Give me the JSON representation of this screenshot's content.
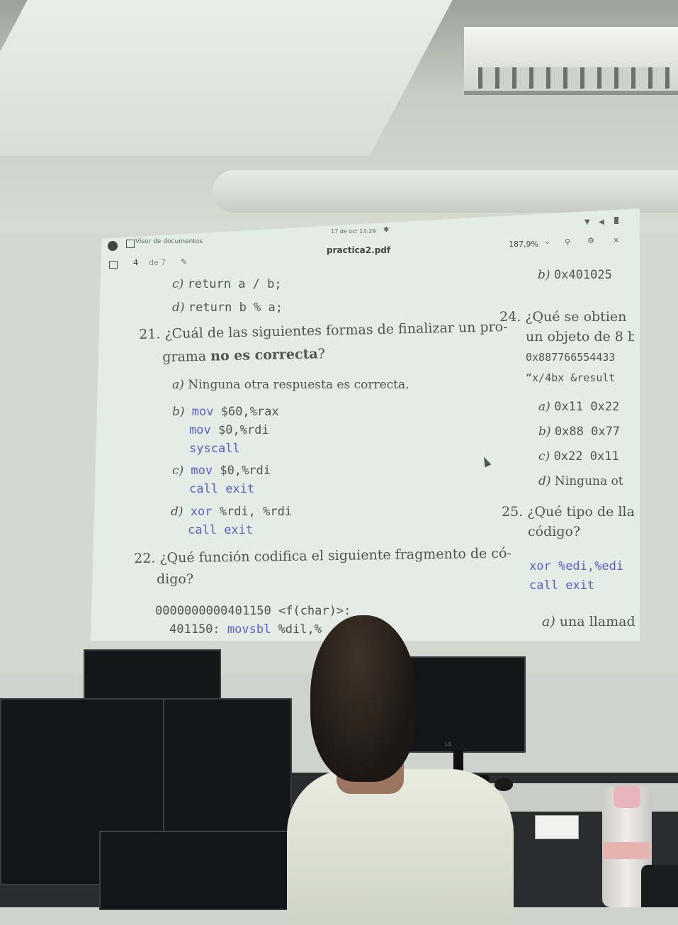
{
  "viewer": {
    "app_name": "Visor de documentos",
    "clock": "17 de oct  13:29",
    "filename": "practica2.pdf",
    "zoom": "187,9%",
    "page_current": "4",
    "page_total": "de 7"
  },
  "left_column": {
    "prev_options": [
      {
        "letter": "c)",
        "code": "return a / b;"
      },
      {
        "letter": "d)",
        "code": "return b % a;"
      }
    ],
    "q21": {
      "number": "21.",
      "text_line1": "¿Cuál de las siguientes formas de finalizar un pro-",
      "text_line2_pre": "grama ",
      "text_line2_bold": "no es correcta",
      "text_line2_post": "?",
      "options": {
        "a_letter": "a)",
        "a_text": "Ninguna otra respuesta es correcta.",
        "b_letter": "b)",
        "b_line1_kw": "mov",
        "b_line1_arg": " $60,%rax",
        "b_line2_kw": "mov",
        "b_line2_arg": " $0,%rdi",
        "b_line3_kw": "syscall",
        "c_letter": "c)",
        "c_line1_kw": "mov",
        "c_line1_arg": " $0,%rdi",
        "c_line2_kw": "call",
        "c_line2_arg": " exit",
        "d_letter": "d)",
        "d_line1_kw": "xor",
        "d_line1_arg": " %rdi, %rdi",
        "d_line2_kw": "call",
        "d_line2_arg": " exit"
      }
    },
    "q22": {
      "number": "22.",
      "text_line1": "¿Qué función codifica el siguiente fragmento de có-",
      "text_line2": "digo?",
      "code_line1": "0000000000401150 <f(char)>:",
      "code_line2_addr": "401150:",
      "code_line2_kw": "movsbl",
      "code_line2_arg": " %dil,%"
    }
  },
  "right_column": {
    "prev_b_letter": "b)",
    "prev_b_value": "0x401025",
    "q24": {
      "number": "24.",
      "line1": "¿Qué se obtien",
      "line2": "un objeto de 8 b",
      "line3": "0x887766554433",
      "line4": "“x/4bx &result",
      "a_letter": "a)",
      "a_text": "0x11 0x22",
      "b_letter": "b)",
      "b_text": "0x88 0x77",
      "c_letter": "c)",
      "c_text": "0x22 0x11",
      "d_letter": "d)",
      "d_text": "Ninguna ot"
    },
    "q25": {
      "number": "25.",
      "line1": "¿Qué tipo de lla",
      "line2": "código?",
      "code1_kw": "xor",
      "code1_arg": "  %edi,%edi",
      "code2_kw": "call",
      "code2_arg": " exit",
      "a_letter": "a)",
      "a_text": "una llamad"
    }
  },
  "monitor_brand": "LG"
}
